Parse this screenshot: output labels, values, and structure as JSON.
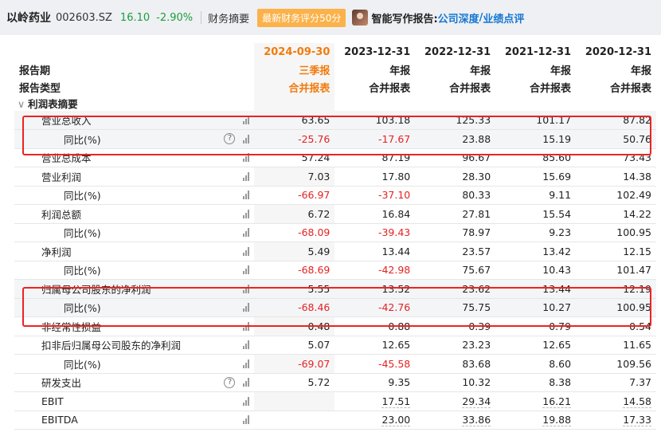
{
  "header": {
    "stock_name": "以岭药业",
    "stock_code": "002603.SZ",
    "price": "16.10",
    "change": "-2.90%",
    "tab_summary": "财务摘要",
    "score_badge": "最新财务评分50分",
    "ai_report_label": "智能写作报告:",
    "link_depth": "公司深度",
    "link_slash": "/",
    "link_review": "业绩点评"
  },
  "table": {
    "period_label": "报告期",
    "type_label": "报告类型",
    "dates": [
      "2024-09-30",
      "2023-12-31",
      "2022-12-31",
      "2021-12-31",
      "2020-12-31"
    ],
    "report_kinds": [
      "三季报",
      "年报",
      "年报",
      "年报",
      "年报"
    ],
    "statement_kinds": [
      "合并报表",
      "合并报表",
      "合并报表",
      "合并报表",
      "合并报表"
    ],
    "section_title": "利润表摘要",
    "rows": [
      {
        "label": "营业总收入",
        "values": [
          "63.65",
          "103.18",
          "125.33",
          "101.17",
          "87.82"
        ]
      },
      {
        "label": "同比(%)",
        "values": [
          "-25.76",
          "-17.67",
          "23.88",
          "15.19",
          "50.76"
        ]
      },
      {
        "label": "营业总成本",
        "values": [
          "57.24",
          "87.19",
          "96.67",
          "85.60",
          "73.43"
        ]
      },
      {
        "label": "营业利润",
        "values": [
          "7.03",
          "17.80",
          "28.30",
          "15.69",
          "14.38"
        ]
      },
      {
        "label": "同比(%)",
        "values": [
          "-66.97",
          "-37.10",
          "80.33",
          "9.11",
          "102.49"
        ]
      },
      {
        "label": "利润总额",
        "values": [
          "6.72",
          "16.84",
          "27.81",
          "15.54",
          "14.22"
        ]
      },
      {
        "label": "同比(%)",
        "values": [
          "-68.09",
          "-39.43",
          "78.97",
          "9.23",
          "100.95"
        ]
      },
      {
        "label": "净利润",
        "values": [
          "5.49",
          "13.44",
          "23.57",
          "13.42",
          "12.15"
        ]
      },
      {
        "label": "同比(%)",
        "values": [
          "-68.69",
          "-42.98",
          "75.67",
          "10.43",
          "101.47"
        ]
      },
      {
        "label": "归属母公司股东的净利润",
        "values": [
          "5.55",
          "13.52",
          "23.62",
          "13.44",
          "12.19"
        ]
      },
      {
        "label": "同比(%)",
        "values": [
          "-68.46",
          "-42.76",
          "75.75",
          "10.27",
          "100.95"
        ]
      },
      {
        "label": "非经常性损益",
        "values": [
          "0.48",
          "0.88",
          "0.39",
          "0.79",
          "0.54"
        ]
      },
      {
        "label": "扣非后归属母公司股东的净利润",
        "values": [
          "5.07",
          "12.65",
          "23.23",
          "12.65",
          "11.65"
        ]
      },
      {
        "label": "同比(%)",
        "values": [
          "-69.07",
          "-45.58",
          "83.68",
          "8.60",
          "109.56"
        ]
      },
      {
        "label": "研发支出",
        "values": [
          "5.72",
          "9.35",
          "10.32",
          "8.38",
          "7.37"
        ]
      },
      {
        "label": "EBIT",
        "values": [
          "",
          "17.51",
          "29.34",
          "16.21",
          "14.58"
        ]
      },
      {
        "label": "EBITDA",
        "values": [
          "",
          "23.00",
          "33.86",
          "19.88",
          "17.33"
        ]
      }
    ]
  },
  "colors": {
    "negative": "#e52222",
    "positive_price": "#1a9e3f",
    "highlight_box": "#ee2222",
    "current_period": "#f27b0c",
    "link": "#1677d2"
  }
}
